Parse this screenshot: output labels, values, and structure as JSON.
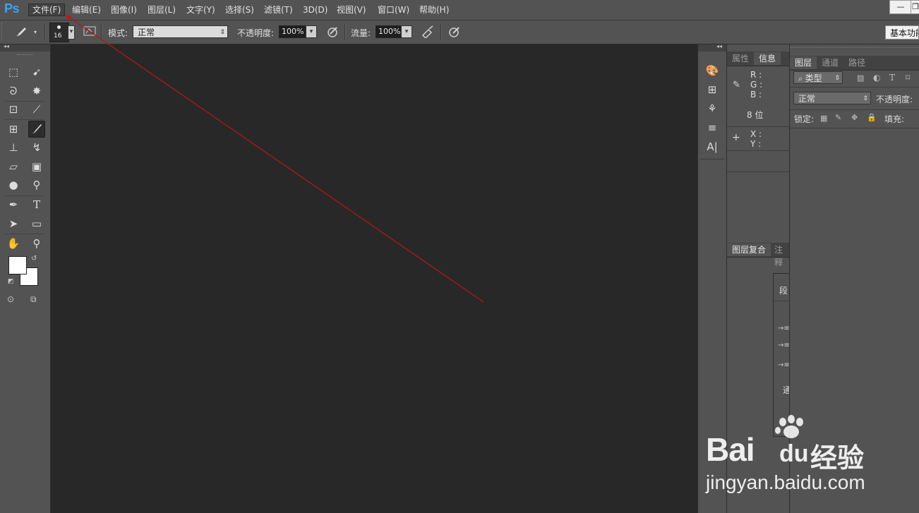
{
  "app": {
    "logo": "Ps"
  },
  "menu": [
    {
      "label": "文件(F)",
      "active": true
    },
    {
      "label": "编辑(E)"
    },
    {
      "label": "图像(I)"
    },
    {
      "label": "图层(L)"
    },
    {
      "label": "文字(Y)"
    },
    {
      "label": "选择(S)"
    },
    {
      "label": "滤镜(T)"
    },
    {
      "label": "3D(D)"
    },
    {
      "label": "视图(V)"
    },
    {
      "label": "窗口(W)"
    },
    {
      "label": "帮助(H)"
    }
  ],
  "window_controls": {
    "minimize": "—",
    "restore": "❐"
  },
  "options": {
    "brush_size": "16",
    "mode_label": "模式:",
    "mode_value": "正常",
    "opacity_label": "不透明度:",
    "opacity_value": "100%",
    "flow_label": "流量:",
    "flow_value": "100%",
    "workspace": "基本功能"
  },
  "info_panel": {
    "tabs": [
      "属性",
      "信息"
    ],
    "active_tab": "信息",
    "r": "R :",
    "g": "G :",
    "b": "B :",
    "bits": "8 位",
    "x": "X :",
    "y": "Y :"
  },
  "layer_comps_panel": {
    "tabs": [
      "图层复合",
      "注释"
    ]
  },
  "paragraph_panel": {
    "tab": "段",
    "glyph": "通"
  },
  "layers_panel": {
    "tabs": [
      "图层",
      "通道",
      "路径"
    ],
    "active_tab": "图层",
    "filter_kind": "类型",
    "blend_mode": "正常",
    "opacity_label": "不透明度:",
    "lock_label": "锁定:",
    "fill_label": "填充:"
  },
  "watermark": {
    "brand": "Bai",
    "brand2": "du",
    "cn": "经验",
    "url": "jingyan.baidu.com"
  },
  "colors": {
    "accent_logo": "#3fa1f0",
    "annotation": "#b01818",
    "foreground": "#ffffff",
    "background": "#ffffff"
  },
  "icons": {
    "tools": [
      "marquee-icon",
      "move-icon",
      "lasso-icon",
      "magic-wand-icon",
      "crop-icon",
      "eyedropper-icon",
      "healing-icon",
      "brush-icon",
      "stamp-icon",
      "history-brush-icon",
      "eraser-icon",
      "gradient-icon",
      "blur-icon",
      "dodge-icon",
      "pen-icon",
      "type-icon",
      "path-select-icon",
      "rectangle-icon",
      "hand-icon",
      "zoom-icon"
    ]
  }
}
